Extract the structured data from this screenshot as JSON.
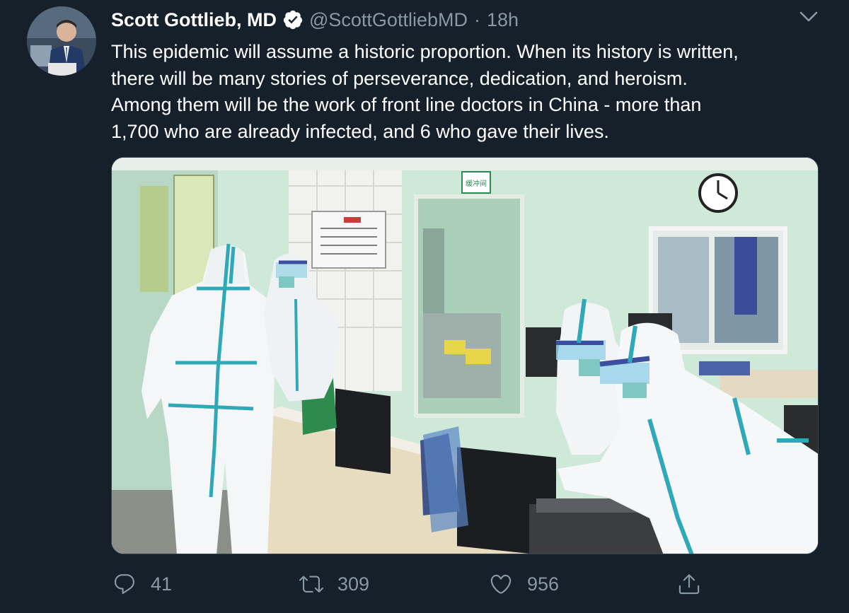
{
  "author": {
    "name": "Scott Gottlieb, MD",
    "handle": "@ScottGottliebMD",
    "separator": "·",
    "time": "18h",
    "verified_icon": "verified-badge-icon",
    "avatar_alt": "profile photo"
  },
  "tweet": {
    "text": "This epidemic will assume a historic proportion. When its history is written,\nthere will be many stories of perseverance, dedication, and heroism.\nAmong them will be the work of front line doctors in China - more than\n1,700 who are already infected, and 6 who gave their lives."
  },
  "media": {
    "description_icon": "photo",
    "photo_sign_text": "缓冲间"
  },
  "actions": {
    "reply_count": "41",
    "retweet_count": "309",
    "like_count": "956",
    "share_icon": "share-icon"
  },
  "colors": {
    "background": "#15202b",
    "primary_text": "#ffffff",
    "secondary_text": "#8899a6",
    "border": "#38444d"
  }
}
